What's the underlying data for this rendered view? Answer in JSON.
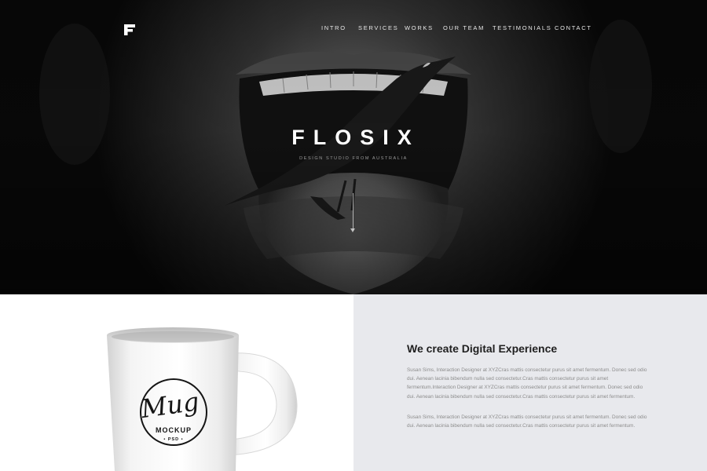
{
  "logo": {
    "letter": "F"
  },
  "nav": {
    "items": [
      {
        "label": "INTRO"
      },
      {
        "label": "SERVICES"
      },
      {
        "label": "WORKS"
      },
      {
        "label": "OUR TEAM"
      },
      {
        "label": "TESTIMONIALS"
      },
      {
        "label": "CONTACT"
      }
    ]
  },
  "hero": {
    "title": "FLOSIX",
    "subtitle": "DESIGN STUDIO FROM AUSTRALIA",
    "scroll_icon": "arrow-down-icon"
  },
  "mug": {
    "script_text": "Mug",
    "label": "MOCKUP",
    "sub_label": "• PSD •"
  },
  "about": {
    "title": "We create Digital Experience",
    "paragraph_1": "Susan Sims, Interaction Designer at XYZCras mattis consectetur purus sit amet fermentum. Donec sed odio dui. Aenean lacinia bibendum nulla sed consectetur.Cras mattis consectetur purus sit amet fermentum.Interaction Designer at XYZCras mattis consectetur purus sit amet fermentum. Donec sed odio dui. Aenean lacinia bibendum nulla sed consectetur.Cras mattis consectetur purus sit amet fermentum.",
    "paragraph_2": "Susan Sims, Interaction Designer at XYZCras mattis consectetur purus sit amet fermentum. Donec sed odio dui. Aenean lacinia bibendum nulla sed consectetur.Cras mattis consectetur purus sit amet fermentum."
  },
  "colors": {
    "hero_bg": "#0a0a0a",
    "panel_bg": "#e8e9ed",
    "title_text": "#1f1f1f",
    "body_text": "#8c8c8c"
  }
}
